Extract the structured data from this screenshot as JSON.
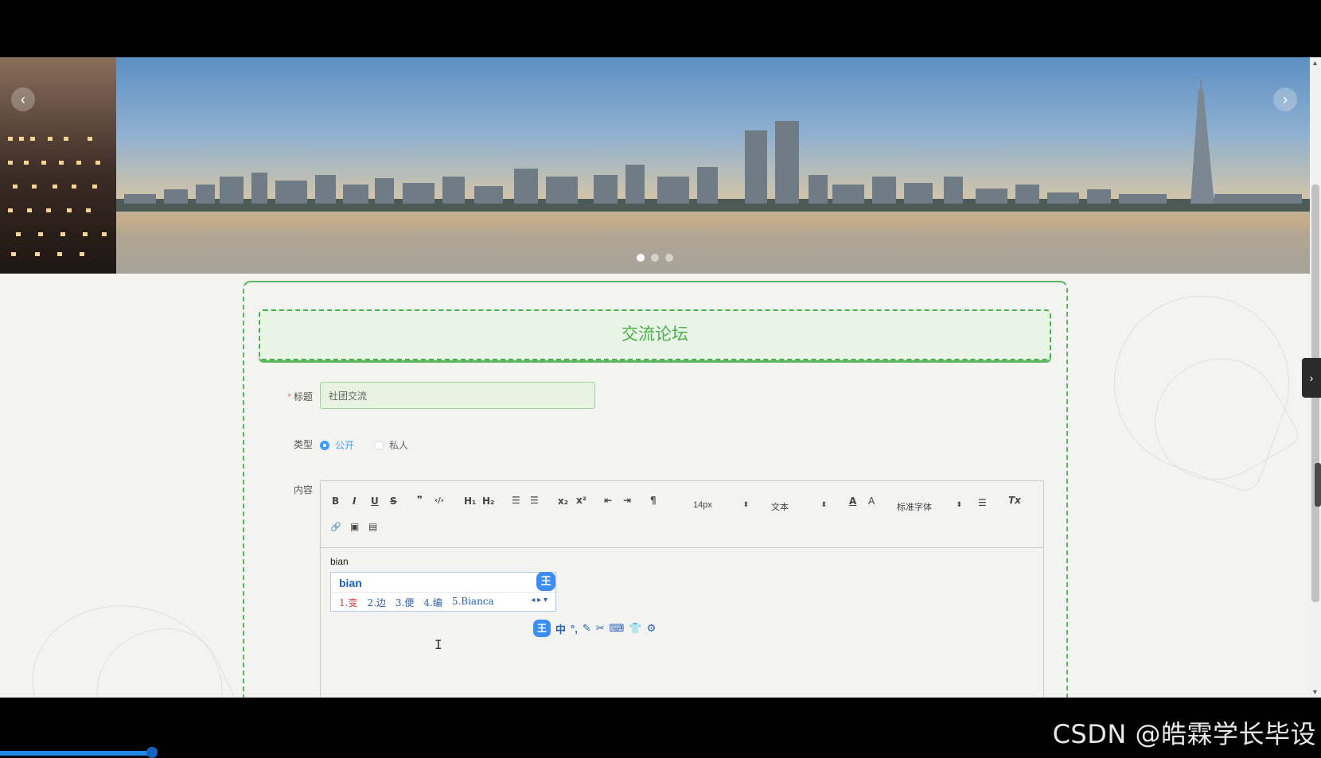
{
  "banner": {
    "prev_arrow": "‹",
    "next_arrow": "›",
    "slide_count": 3,
    "active_slide": 1
  },
  "forum": {
    "heading": "交流论坛",
    "title_label": "标题",
    "title_required_mark": "*",
    "title_value": "社团交流",
    "type_label": "类型",
    "type_options": [
      "公开",
      "私人"
    ],
    "type_selected": "公开",
    "content_label": "内容"
  },
  "editor": {
    "toolbar": {
      "bold": "B",
      "italic": "I",
      "underline": "U",
      "strike": "S",
      "blockquote": "❞",
      "code": "‹/›",
      "h1": "H₁",
      "h2": "H₂",
      "ordered_list": "☰",
      "bullet_list": "☰",
      "subscript": "x₂",
      "superscript": "x²",
      "outdent": "⇤",
      "indent": "⇥",
      "rtl": "¶",
      "font_size": "14px",
      "header_select": "文本",
      "font_family": "标准字体",
      "clean": "Tx",
      "link": "🔗",
      "image": "▣",
      "video": "▤",
      "color": "A",
      "background": "A"
    },
    "body_text": "bian",
    "ime": {
      "pinyin": "bian",
      "logo": "王",
      "candidates": [
        "1.变",
        "2.边",
        "3.便",
        "4.编",
        "5.Bianca"
      ],
      "nav": "◂ ▸ ▾"
    }
  },
  "ime_status_bar": {
    "logo": "王",
    "items": [
      "中",
      "°,",
      "✎",
      "✂",
      "⌨",
      "👕",
      "⚙"
    ]
  },
  "side_tab_icon": "›",
  "watermark": "CSDN @皓霖学长毕设",
  "colors": {
    "accent_green": "#5cb85c",
    "radio_blue": "#409eff",
    "required_red": "#f56c6c"
  }
}
